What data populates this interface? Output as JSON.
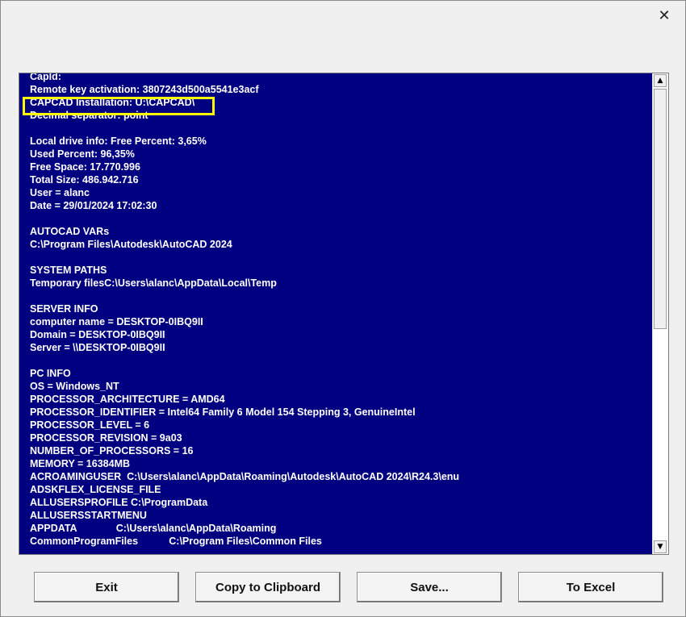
{
  "window": {
    "close_label": "✕"
  },
  "info_lines": [
    "CapId:",
    "Remote key activation: 3807243d500a5541e3acf",
    "CAPCAD Installation: U:\\CAPCAD\\",
    "Decimal separator: point",
    "",
    "Local drive info: Free Percent: 3,65%",
    "Used Percent: 96,35%",
    "Free Space: 17.770.996",
    "Total Size: 486.942.716",
    "User = alanc",
    "Date = 29/01/2024 17:02:30",
    "",
    "AUTOCAD VARs",
    "C:\\Program Files\\Autodesk\\AutoCAD 2024",
    "",
    "SYSTEM PATHS",
    "Temporary filesC:\\Users\\alanc\\AppData\\Local\\Temp",
    "",
    "SERVER INFO",
    "computer name = DESKTOP-0IBQ9II",
    "Domain = DESKTOP-0IBQ9II",
    "Server = \\\\DESKTOP-0IBQ9II",
    "",
    "PC INFO",
    "OS = Windows_NT",
    "PROCESSOR_ARCHITECTURE = AMD64",
    "PROCESSOR_IDENTIFIER = Intel64 Family 6 Model 154 Stepping 3, GenuineIntel",
    "PROCESSOR_LEVEL = 6",
    "PROCESSOR_REVISION = 9a03",
    "NUMBER_OF_PROCESSORS = 16",
    "MEMORY = 16384MB",
    "ACROAMINGUSER  C:\\Users\\alanc\\AppData\\Roaming\\Autodesk\\AutoCAD 2024\\R24.3\\enu",
    "ADSKFLEX_LICENSE_FILE",
    "ALLUSERSPROFILE C:\\ProgramData",
    "ALLUSERSSTARTMENU",
    "APPDATA              C:\\Users\\alanc\\AppData\\Roaming",
    "CommonProgramFiles           C:\\Program Files\\Common Files"
  ],
  "scrollbar": {
    "up_arrow": "▲",
    "down_arrow": "▼"
  },
  "buttons": {
    "exit": "Exit",
    "copy": "Copy to Clipboard",
    "save": "Save...",
    "excel": "To Excel"
  },
  "colors": {
    "text_background": "#000080",
    "text_color": "#ffffff",
    "highlight_border": "#ffff00"
  }
}
